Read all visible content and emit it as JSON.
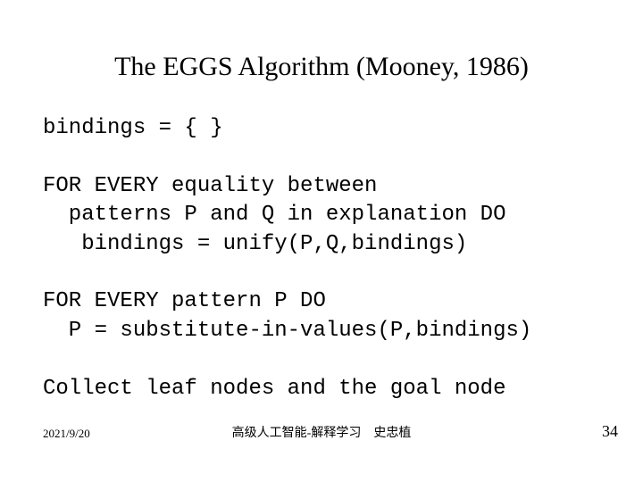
{
  "title": "The EGGS Algorithm (Mooney, 1986)",
  "lines": {
    "l0": "bindings = { }",
    "l1": "",
    "l2": "FOR EVERY equality between",
    "l3": "  patterns P and Q in explanation DO",
    "l4": "   bindings = unify(P,Q,bindings)",
    "l5": "",
    "l6": "FOR EVERY pattern P DO",
    "l7": "  P = substitute-in-values(P,bindings)",
    "l8": "",
    "l9": "Collect leaf nodes and the goal node"
  },
  "footer": {
    "date": "2021/9/20",
    "center": "高级人工智能-解释学习　史忠植",
    "page": "34"
  }
}
